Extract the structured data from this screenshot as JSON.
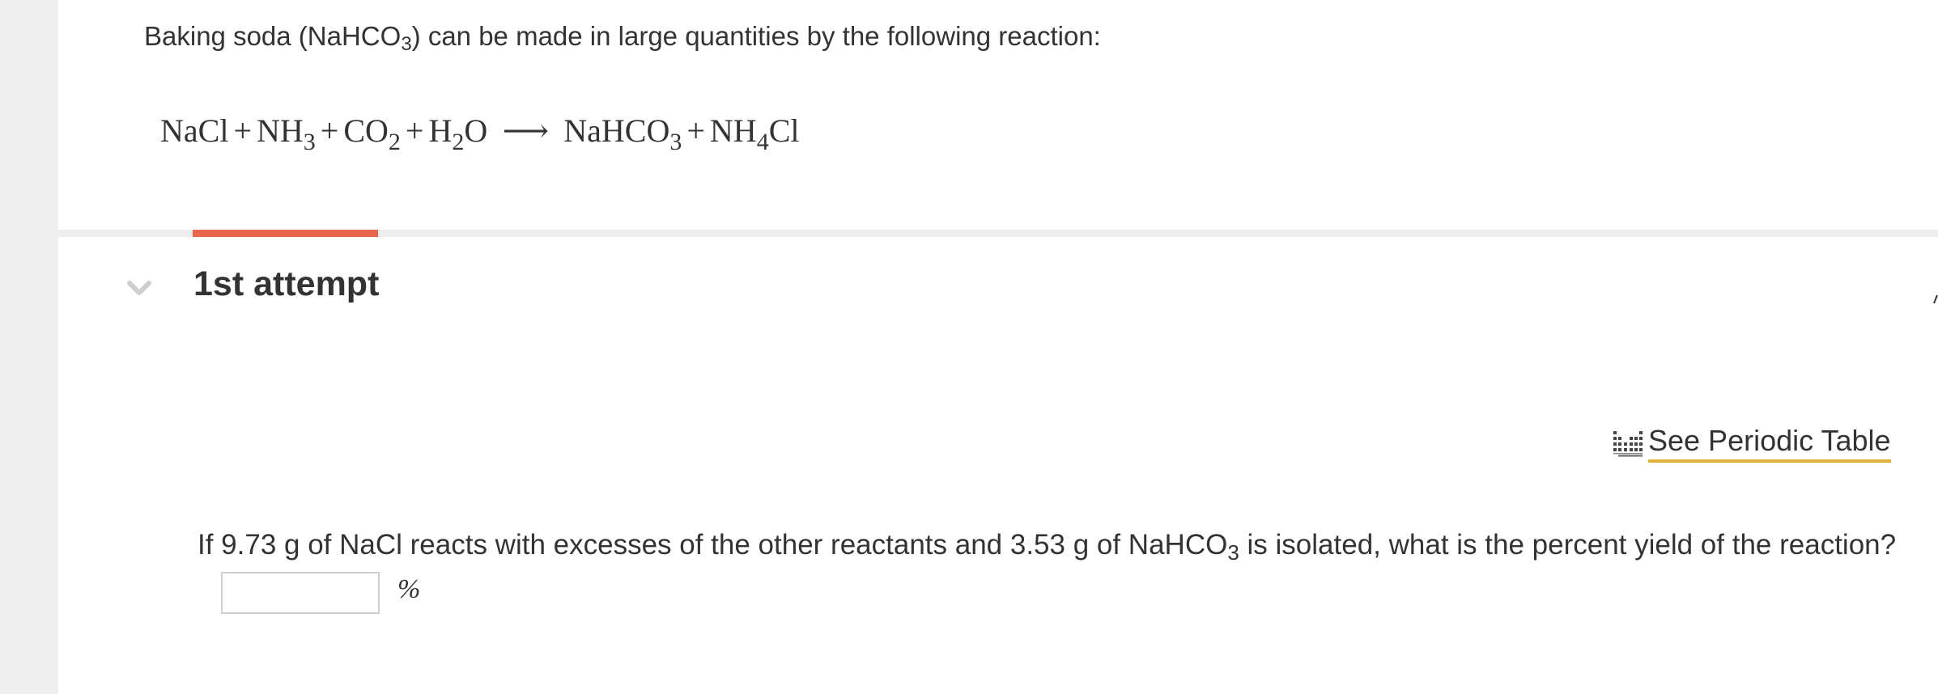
{
  "intro": {
    "text_before": "Baking soda (NaHCO",
    "sub": "3",
    "text_after": ") can be made in large quantities by the following reaction:"
  },
  "equation": {
    "reactants": [
      {
        "base": "NaCl",
        "sub": ""
      },
      {
        "base": "NH",
        "sub": "3"
      },
      {
        "base": "CO",
        "sub": "2"
      },
      {
        "base": "H",
        "sub": "2",
        "tail": "O"
      }
    ],
    "arrow": "⟶",
    "plus": "+",
    "products": [
      {
        "base": "NaHCO",
        "sub": "3"
      },
      {
        "base": "NH",
        "sub": "4",
        "tail": "Cl"
      }
    ]
  },
  "attempt": {
    "title": "1st attempt",
    "accent_color": "#e8674c"
  },
  "periodic_table_link": {
    "label": "See Periodic Table",
    "icon": "periodic-table-icon",
    "underline_color": "#e3b23c"
  },
  "question": {
    "text_before": "If 9.73 g of NaCl reacts with excesses of the other reactants and 3.53 g of NaHCO",
    "sub": "3",
    "text_after": " is isolated, what is the percent yield of the reaction?"
  },
  "answer": {
    "value": "",
    "unit": "%"
  }
}
